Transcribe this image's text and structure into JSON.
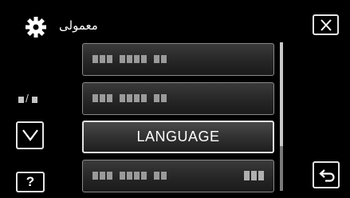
{
  "header": {
    "title": "معمولی",
    "settings_icon": "gear-icon",
    "close_icon": "close-icon"
  },
  "navigation": {
    "page_indicator": "■/■",
    "down_icon": "chevron-down-icon",
    "help_label": "?",
    "back_icon": "back-arrow-icon"
  },
  "menu": {
    "items": [
      {
        "label": ""
      },
      {
        "label": ""
      },
      {
        "label": "LANGUAGE",
        "selected": true
      },
      {
        "label": ""
      }
    ]
  },
  "colors": {
    "background": "#000000",
    "button_border": "#e6e6e6",
    "item_border": "#8a8a8a",
    "text": "#ffffff"
  }
}
